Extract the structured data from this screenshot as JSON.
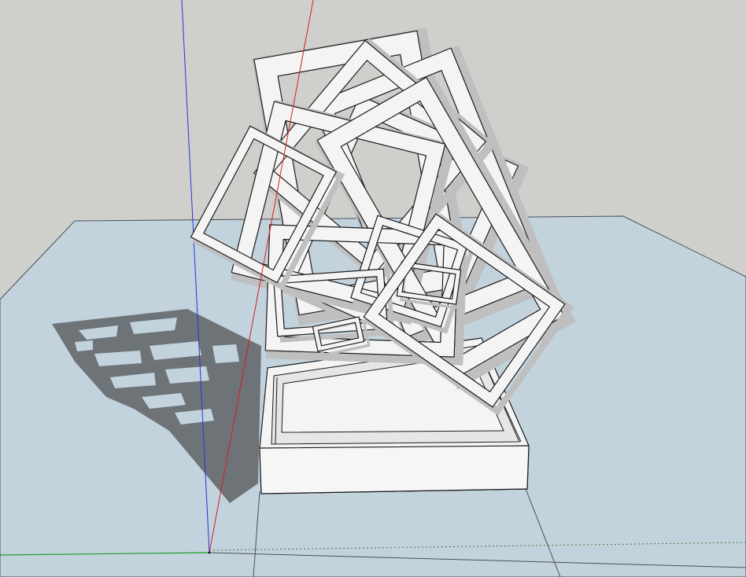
{
  "viewport": {
    "sky_color": "#cfd0cc",
    "ground_color": "#c3d3de",
    "ground_edge_color": "#4a4f57",
    "shadow_color": "#6e7378",
    "model_face_color": "#f4f4f4",
    "model_side_color": "#bfbfbf",
    "model_edge_color": "#1b1b1b"
  },
  "axes": {
    "red_axis": {
      "name": "red-axis",
      "color": "#d21f1f"
    },
    "green_axis": {
      "name": "green-axis",
      "color": "#1f9a2b"
    },
    "blue_axis": {
      "name": "blue-axis",
      "color": "#2435d6"
    }
  },
  "model": {
    "type": "rotating-square-frames-sculpture",
    "frame_count": 13
  }
}
